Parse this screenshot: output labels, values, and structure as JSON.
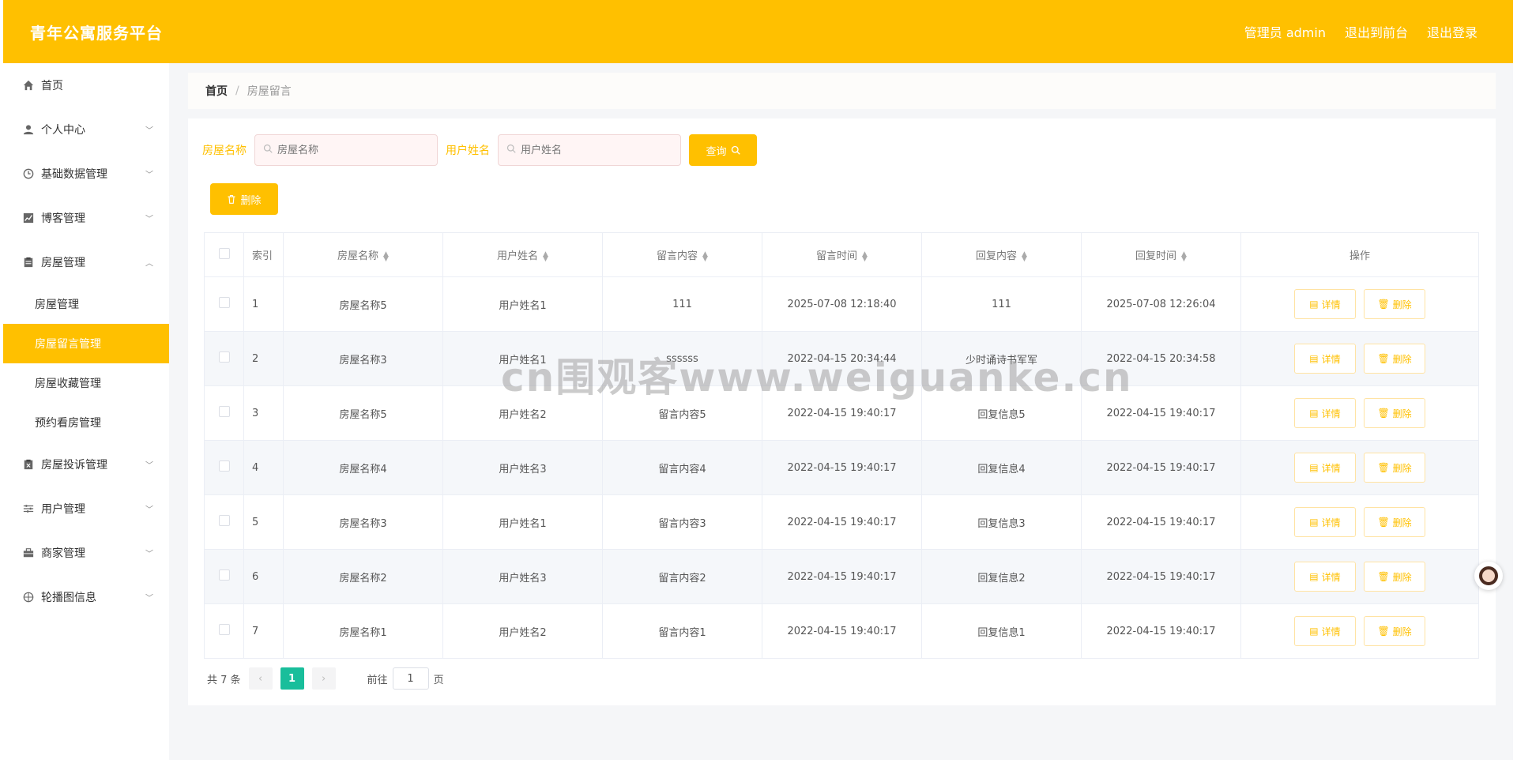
{
  "header": {
    "brand": "青年公寓服务平台",
    "admin_label": "管理员 admin",
    "to_front": "退出到前台",
    "logout": "退出登录"
  },
  "sidebar": {
    "items": [
      {
        "label": "首页",
        "icon": "home-icon",
        "has_chevron": false
      },
      {
        "label": "个人中心",
        "icon": "user-icon",
        "has_chevron": true
      },
      {
        "label": "基础数据管理",
        "icon": "clock-icon",
        "has_chevron": true
      },
      {
        "label": "博客管理",
        "icon": "chart-icon",
        "has_chevron": true
      },
      {
        "label": "房屋管理",
        "icon": "clipboard-icon",
        "has_chevron": true,
        "expanded": true
      },
      {
        "label": "房屋投诉管理",
        "icon": "clipboard-x-icon",
        "has_chevron": true
      },
      {
        "label": "用户管理",
        "icon": "sliders-icon",
        "has_chevron": true
      },
      {
        "label": "商家管理",
        "icon": "briefcase-icon",
        "has_chevron": true
      },
      {
        "label": "轮播图信息",
        "icon": "compass-icon",
        "has_chevron": true
      }
    ],
    "submenu": [
      {
        "label": "房屋管理",
        "active": false
      },
      {
        "label": "房屋留言管理",
        "active": true
      },
      {
        "label": "房屋收藏管理",
        "active": false
      },
      {
        "label": "预约看房管理",
        "active": false
      }
    ]
  },
  "breadcrumb": {
    "home": "首页",
    "separator": "/",
    "current": "房屋留言"
  },
  "filters": {
    "house_label": "房屋名称",
    "house_placeholder": "房屋名称",
    "user_label": "用户姓名",
    "user_placeholder": "用户姓名",
    "search_button": "查询"
  },
  "toolbar": {
    "delete_button": "删除"
  },
  "table": {
    "headers": [
      "索引",
      "房屋名称",
      "用户姓名",
      "留言内容",
      "留言时间",
      "回复内容",
      "回复时间",
      "操作"
    ],
    "detail_label": "详情",
    "delete_label": "删除",
    "rows": [
      {
        "idx": "1",
        "house": "房屋名称5",
        "user": "用户姓名1",
        "content": "111",
        "time": "2025-07-08 12:18:40",
        "reply": "111",
        "reply_time": "2025-07-08 12:26:04"
      },
      {
        "idx": "2",
        "house": "房屋名称3",
        "user": "用户姓名1",
        "content": "ssssss",
        "time": "2022-04-15 20:34:44",
        "reply": "少时诵诗书军军",
        "reply_time": "2022-04-15 20:34:58"
      },
      {
        "idx": "3",
        "house": "房屋名称5",
        "user": "用户姓名2",
        "content": "留言内容5",
        "time": "2022-04-15 19:40:17",
        "reply": "回复信息5",
        "reply_time": "2022-04-15 19:40:17"
      },
      {
        "idx": "4",
        "house": "房屋名称4",
        "user": "用户姓名3",
        "content": "留言内容4",
        "time": "2022-04-15 19:40:17",
        "reply": "回复信息4",
        "reply_time": "2022-04-15 19:40:17"
      },
      {
        "idx": "5",
        "house": "房屋名称3",
        "user": "用户姓名1",
        "content": "留言内容3",
        "time": "2022-04-15 19:40:17",
        "reply": "回复信息3",
        "reply_time": "2022-04-15 19:40:17"
      },
      {
        "idx": "6",
        "house": "房屋名称2",
        "user": "用户姓名3",
        "content": "留言内容2",
        "time": "2022-04-15 19:40:17",
        "reply": "回复信息2",
        "reply_time": "2022-04-15 19:40:17"
      },
      {
        "idx": "7",
        "house": "房屋名称1",
        "user": "用户姓名2",
        "content": "留言内容1",
        "time": "2022-04-15 19:40:17",
        "reply": "回复信息1",
        "reply_time": "2022-04-15 19:40:17"
      }
    ]
  },
  "pagination": {
    "total": "共 7 条",
    "current_page": "1",
    "goto_prefix": "前往",
    "goto_value": "1",
    "goto_suffix": "页"
  },
  "watermark": "cn围观客www.weiguanke.cn",
  "colors": {
    "accent": "#FFC000",
    "pager_active": "#19be9b"
  }
}
